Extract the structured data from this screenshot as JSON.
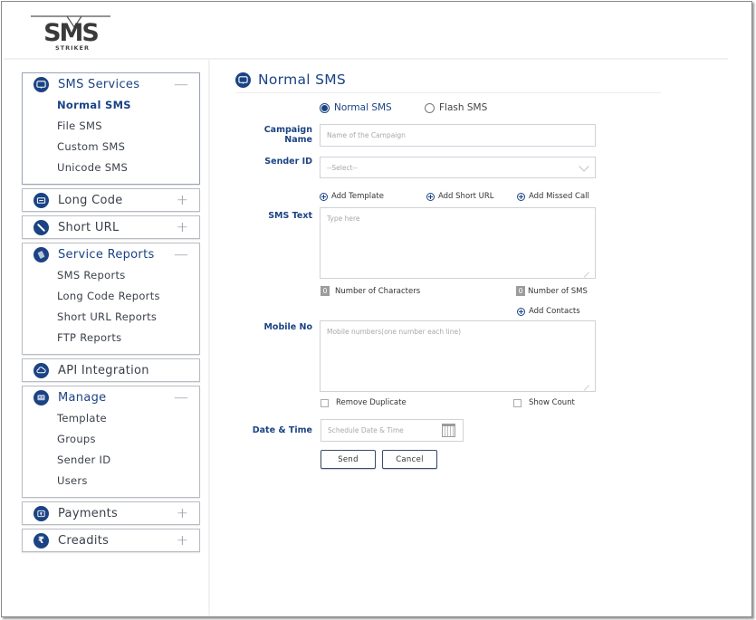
{
  "app": {
    "brand": "SMS",
    "brand_sub": "STRIKER"
  },
  "sidebar": {
    "sections": [
      {
        "label": "SMS Services",
        "icon": "chat-bubble-icon",
        "expanded": true,
        "toggle": "—",
        "items": [
          {
            "label": "Normal SMS",
            "active": true
          },
          {
            "label": "File SMS"
          },
          {
            "label": "Custom SMS"
          },
          {
            "label": "Unicode SMS"
          }
        ]
      },
      {
        "label": "Long Code",
        "icon": "long-code-icon",
        "expanded": false,
        "toggle": "+"
      },
      {
        "label": "Short URL",
        "icon": "link-icon",
        "expanded": false,
        "toggle": "+"
      },
      {
        "label": "Service Reports",
        "icon": "reports-icon",
        "expanded": true,
        "toggle": "—",
        "items": [
          {
            "label": "SMS Reports"
          },
          {
            "label": "Long Code Reports"
          },
          {
            "label": "Short URL Reports"
          },
          {
            "label": "FTP Reports"
          }
        ]
      },
      {
        "label": "API Integration",
        "icon": "cloud-icon",
        "expanded": false,
        "toggle": ""
      },
      {
        "label": "Manage",
        "icon": "monitor-icon",
        "expanded": true,
        "toggle": "—",
        "items": [
          {
            "label": "Template"
          },
          {
            "label": "Groups"
          },
          {
            "label": "Sender ID"
          },
          {
            "label": "Users"
          }
        ]
      },
      {
        "label": "Payments",
        "icon": "payment-icon",
        "expanded": false,
        "toggle": "+"
      },
      {
        "label": "Creadits",
        "icon": "rupee-icon",
        "expanded": false,
        "toggle": "+"
      }
    ]
  },
  "main": {
    "title": "Normal SMS",
    "sms_type": {
      "options": [
        "Normal SMS",
        "Flash SMS"
      ],
      "selected": "Normal SMS"
    },
    "campaign_name": {
      "label": "Campaign Name",
      "value": "",
      "placeholder": "Name of the Campaign"
    },
    "sender_id": {
      "label": "Sender ID",
      "selected": "--Select--"
    },
    "actions": {
      "add_template": "Add Template",
      "add_short_url": "Add Short URL",
      "add_missed_call": "Add Missed Call",
      "add_contacts": "Add Contacts"
    },
    "sms_text": {
      "label": "SMS Text",
      "value": "",
      "placeholder": "Type here"
    },
    "counters": {
      "characters": {
        "value": "0",
        "label": "Number of Characters"
      },
      "sms": {
        "value": "0",
        "label": "Number of SMS"
      }
    },
    "mobile_no": {
      "label": "Mobile No",
      "value": "",
      "placeholder": "Mobile numbers(one number each line)"
    },
    "options": {
      "remove_duplicate": {
        "label": "Remove Duplicate",
        "checked": false
      },
      "show_count": {
        "label": "Show Count",
        "checked": false
      }
    },
    "date_time": {
      "label": "Date & Time",
      "value": "",
      "placeholder": "Schedule Date & Time"
    },
    "buttons": {
      "send": "Send",
      "cancel": "Cancel"
    }
  }
}
